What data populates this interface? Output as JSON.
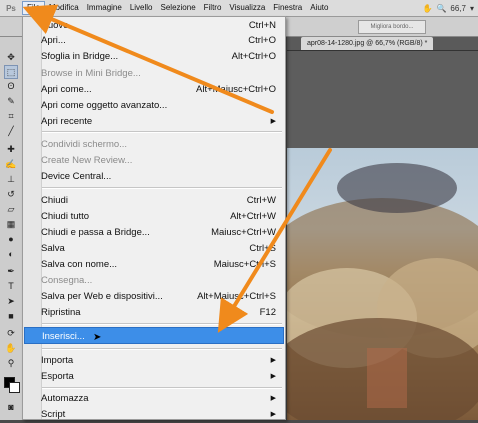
{
  "menubar": {
    "logo": "Ps",
    "items": [
      "File",
      "Modifica",
      "Immagine",
      "Livello",
      "Selezione",
      "Filtro",
      "Visualizza",
      "Finestra",
      "Aiuto"
    ],
    "zoom": "66,7"
  },
  "options_bar": {
    "refine_edge": "Migliora bordo..."
  },
  "document_tab": "apr08-14-1280.jpg @ 66,7% (RGB/8) *",
  "file_menu": {
    "items": [
      {
        "label": "Nuovo...",
        "shortcut": "Ctrl+N"
      },
      {
        "label": "Apri...",
        "shortcut": "Ctrl+O"
      },
      {
        "label": "Sfoglia in Bridge...",
        "shortcut": "Alt+Ctrl+O"
      },
      {
        "label": "Browse in Mini Bridge...",
        "shortcut": ""
      },
      {
        "label": "Apri come...",
        "shortcut": "Alt+Maiusc+Ctrl+O"
      },
      {
        "label": "Apri come oggetto avanzato...",
        "shortcut": ""
      },
      {
        "label": "Apri recente",
        "shortcut": ""
      },
      {
        "label": "Condividi schermo...",
        "shortcut": ""
      },
      {
        "label": "Create New Review...",
        "shortcut": ""
      },
      {
        "label": "Device Central...",
        "shortcut": ""
      },
      {
        "label": "Chiudi",
        "shortcut": "Ctrl+W"
      },
      {
        "label": "Chiudi tutto",
        "shortcut": "Alt+Ctrl+W"
      },
      {
        "label": "Chiudi e passa a Bridge...",
        "shortcut": "Maiusc+Ctrl+W"
      },
      {
        "label": "Salva",
        "shortcut": "Ctrl+S"
      },
      {
        "label": "Salva con nome...",
        "shortcut": "Maiusc+Ctrl+S"
      },
      {
        "label": "Consegna...",
        "shortcut": ""
      },
      {
        "label": "Salva per Web e dispositivi...",
        "shortcut": "Alt+Maiusc+Ctrl+S"
      },
      {
        "label": "Ripristina",
        "shortcut": "F12"
      },
      {
        "label": "Inserisci...",
        "shortcut": ""
      },
      {
        "label": "Importa",
        "shortcut": ""
      },
      {
        "label": "Esporta",
        "shortcut": ""
      },
      {
        "label": "Automazza",
        "shortcut": ""
      },
      {
        "label": "Script",
        "shortcut": ""
      }
    ]
  },
  "colors": {
    "highlight": "#3d8ee8",
    "annotation_arrow": "#f08a1c"
  }
}
